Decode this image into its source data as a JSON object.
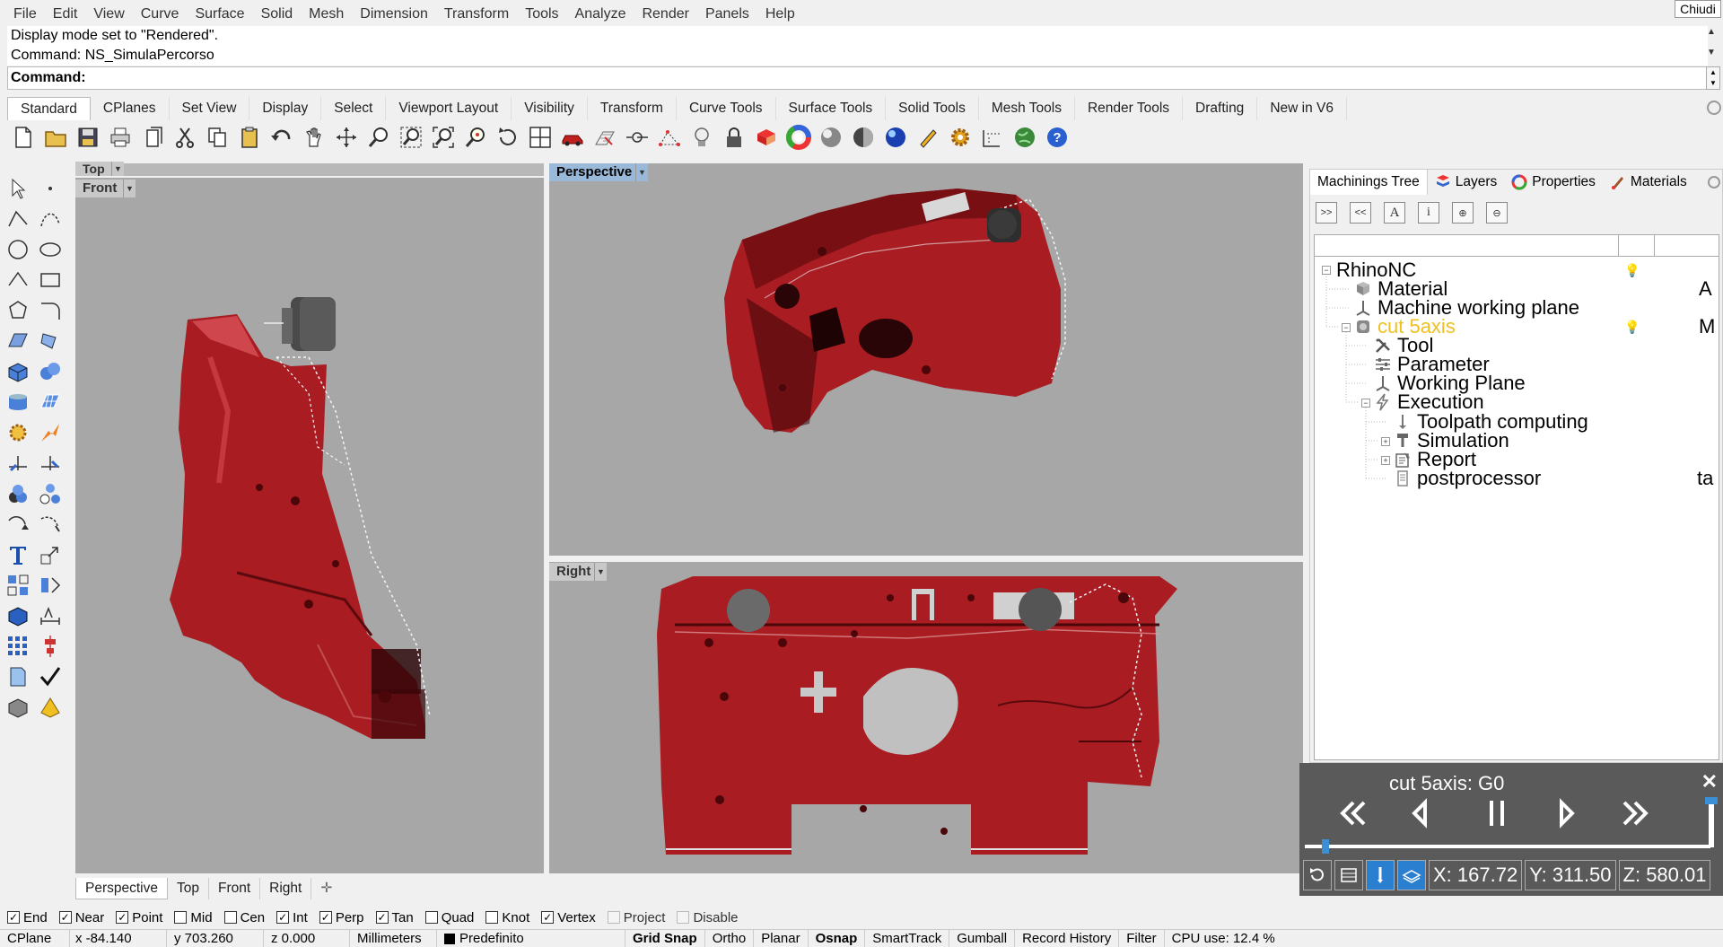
{
  "menu": [
    "File",
    "Edit",
    "View",
    "Curve",
    "Surface",
    "Solid",
    "Mesh",
    "Dimension",
    "Transform",
    "Tools",
    "Analyze",
    "Render",
    "Panels",
    "Help"
  ],
  "close_label": "Chiudi",
  "history": [
    "Display mode set to \"Rendered\".",
    "Command: NS_SimulaPercorso"
  ],
  "command_label": "Command:",
  "command_value": "",
  "toolbar_tabs": [
    "Standard",
    "CPlanes",
    "Set View",
    "Display",
    "Select",
    "Viewport Layout",
    "Visibility",
    "Transform",
    "Curve Tools",
    "Surface Tools",
    "Solid Tools",
    "Mesh Tools",
    "Render Tools",
    "Drafting",
    "New in V6"
  ],
  "toolbar_icons": [
    "new-icon",
    "open-icon",
    "save-icon",
    "print-icon",
    "import-icon",
    "cut-icon",
    "copy-icon",
    "paste-icon",
    "undo-icon",
    "pan-icon",
    "rotate-view-icon",
    "zoom-icon",
    "zoom-window-icon",
    "zoom-extents-icon",
    "zoom-selected-icon",
    "rotate-icon",
    "four-views-icon",
    "car-icon",
    "grid-icon",
    "cplane-icon",
    "points-icon",
    "light-icon",
    "lock-icon",
    "material-icon",
    "color-wheel-icon",
    "sphere-icon",
    "render-sphere-icon",
    "blue-sphere-icon",
    "pen-icon",
    "gear-icon",
    "dimension-icon",
    "globe-icon",
    "help-icon"
  ],
  "viewports": {
    "top": "Top",
    "front": "Front",
    "perspective": "Perspective",
    "right": "Right"
  },
  "viewport_tabs": [
    "Perspective",
    "Top",
    "Front",
    "Right"
  ],
  "osnaps": [
    {
      "label": "End",
      "checked": true
    },
    {
      "label": "Near",
      "checked": true
    },
    {
      "label": "Point",
      "checked": true
    },
    {
      "label": "Mid",
      "checked": false
    },
    {
      "label": "Cen",
      "checked": false
    },
    {
      "label": "Int",
      "checked": true
    },
    {
      "label": "Perp",
      "checked": true
    },
    {
      "label": "Tan",
      "checked": true
    },
    {
      "label": "Quad",
      "checked": false
    },
    {
      "label": "Knot",
      "checked": false
    },
    {
      "label": "Vertex",
      "checked": true
    },
    {
      "label": "Project",
      "checked": false,
      "dim": true
    },
    {
      "label": "Disable",
      "checked": false,
      "dim": true
    }
  ],
  "status": {
    "cplane": "CPlane",
    "x": "x -84.140",
    "y": "y 703.260",
    "z": "z 0.000",
    "units": "Millimeters",
    "layer": "Predefinito",
    "grid_snap": "Grid Snap",
    "ortho": "Ortho",
    "planar": "Planar",
    "osnap": "Osnap",
    "smarttrack": "SmartTrack",
    "gumball": "Gumball",
    "record_history": "Record History",
    "filter": "Filter",
    "cpu": "CPU use: 12.4 %"
  },
  "panel_tabs": [
    {
      "label": "Machinings Tree",
      "icon": ""
    },
    {
      "label": "Layers",
      "icon": "layers-icon"
    },
    {
      "label": "Properties",
      "icon": "properties-icon"
    },
    {
      "label": "Materials",
      "icon": "materials-icon"
    }
  ],
  "tree": {
    "root": "RhinoNC",
    "material": "Material",
    "material_right": "A",
    "machine_plane": "Machine working plane",
    "machining": "cut 5axis",
    "machining_right": "M",
    "tool": "Tool",
    "parameter": "Parameter",
    "working_plane": "Working Plane",
    "execution": "Execution",
    "toolpath": "Toolpath computing",
    "simulation": "Simulation",
    "report": "Report",
    "postprocessor": "postprocessor",
    "postprocessor_right": "ta"
  },
  "sim": {
    "title": "cut 5axis: G0",
    "progress": 0.05,
    "x": "X: 167.72",
    "y": "Y: 311.50",
    "z": "Z: 580.01"
  },
  "colors": {
    "part": "#b01d23",
    "viewport_bg": "#a7a7a7",
    "active_label": "#9ab8d8",
    "machining_highlight": "#f0c020",
    "sim_bg": "#5a5a5a",
    "accent_blue": "#3b8fd4"
  }
}
